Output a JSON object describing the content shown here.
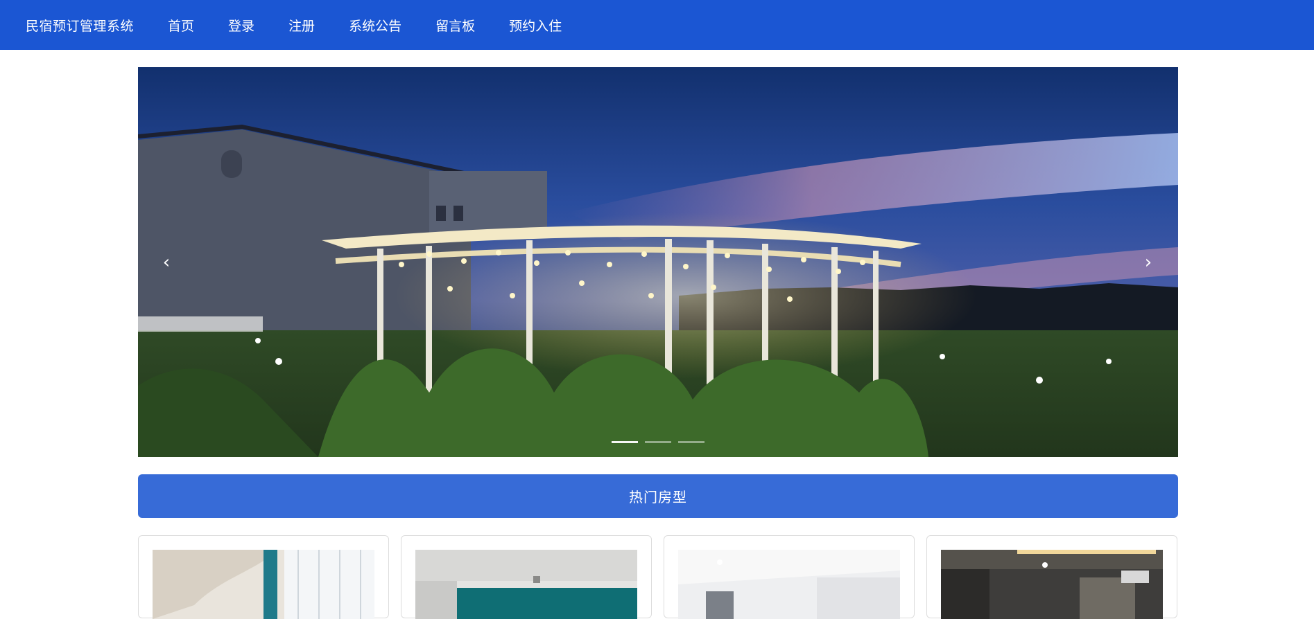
{
  "navbar": {
    "brand": "民宿预订管理系统",
    "items": [
      {
        "label": "首页"
      },
      {
        "label": "登录"
      },
      {
        "label": "注册"
      },
      {
        "label": "系统公告"
      },
      {
        "label": "留言板"
      },
      {
        "label": "预约入住"
      }
    ]
  },
  "carousel": {
    "prev_glyph": "‹",
    "next_glyph": "›",
    "indicator_count": 3,
    "active_index": 0
  },
  "section": {
    "title": "热门房型"
  },
  "rooms": [
    {
      "image": "room-photo"
    },
    {
      "image": "room-photo"
    },
    {
      "image": "room-photo"
    },
    {
      "image": "room-photo"
    }
  ],
  "colors": {
    "nav_bg": "#1b56d3",
    "section_bar_bg": "#376bd7",
    "card_border": "#dcdcdc"
  }
}
